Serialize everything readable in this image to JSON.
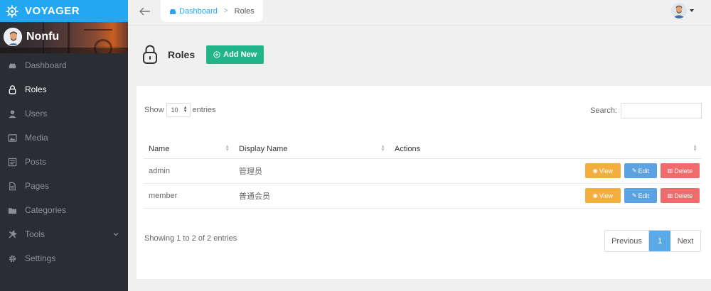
{
  "brand": {
    "title": "VOYAGER",
    "color": "#22a7f0"
  },
  "profile": {
    "name": "Nonfu"
  },
  "sidebar": {
    "items": [
      {
        "label": "Dashboard",
        "icon": "dashboard-icon",
        "active": false
      },
      {
        "label": "Roles",
        "icon": "lock-icon",
        "active": true
      },
      {
        "label": "Users",
        "icon": "user-icon",
        "active": false
      },
      {
        "label": "Media",
        "icon": "image-icon",
        "active": false
      },
      {
        "label": "Posts",
        "icon": "document-icon",
        "active": false
      },
      {
        "label": "Pages",
        "icon": "page-icon",
        "active": false
      },
      {
        "label": "Categories",
        "icon": "folder-icon",
        "active": false
      },
      {
        "label": "Tools",
        "icon": "tools-icon",
        "active": false,
        "has_submenu": true
      },
      {
        "label": "Settings",
        "icon": "gear-icon",
        "active": false
      }
    ]
  },
  "breadcrumb": {
    "home": "Dashboard",
    "current": "Roles"
  },
  "page": {
    "title": "Roles",
    "add_label": "Add New",
    "add_color": "#22b589"
  },
  "table_controls": {
    "show_label": "Show",
    "entries_value": "10",
    "entries_label": "entries",
    "search_label": "Search:",
    "search_value": ""
  },
  "table": {
    "columns": [
      "Name",
      "Display Name",
      "Actions"
    ],
    "rows": [
      {
        "name": "admin",
        "display_name": "管理员"
      },
      {
        "name": "member",
        "display_name": "普通会员"
      }
    ],
    "actions": {
      "view": "View",
      "edit": "Edit",
      "delete": "Delete"
    },
    "action_colors": {
      "view": "#f3ae40",
      "edit": "#5ba2e3",
      "delete": "#f06b6b"
    }
  },
  "footer": {
    "info": "Showing 1 to 2 of 2 entries",
    "prev": "Previous",
    "page": "1",
    "next": "Next"
  }
}
